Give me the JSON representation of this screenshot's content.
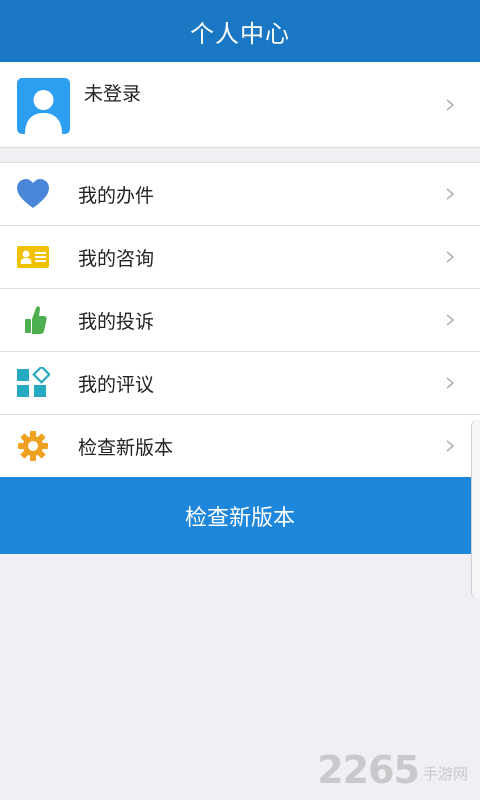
{
  "header": {
    "title": "个人中心"
  },
  "profile": {
    "name": "未登录",
    "avatar_icon": "user-avatar-icon"
  },
  "menu": {
    "items": [
      {
        "label": "我的办件",
        "icon": "heart-icon",
        "color": "#4a86d8"
      },
      {
        "label": "我的咨询",
        "icon": "id-card-icon",
        "color": "#f2c200"
      },
      {
        "label": "我的投诉",
        "icon": "thumbs-up-icon",
        "color": "#4caf50"
      },
      {
        "label": "我的评议",
        "icon": "apps-icon",
        "color": "#25a9c0"
      },
      {
        "label": "检查新版本",
        "icon": "gear-icon",
        "color": "#f0a020"
      }
    ]
  },
  "action": {
    "label": "检查新版本"
  },
  "watermark": {
    "number": "2265",
    "text": "手游网"
  },
  "colors": {
    "header": "#1a77c4",
    "button": "#1f87db",
    "background": "#efeff4"
  }
}
